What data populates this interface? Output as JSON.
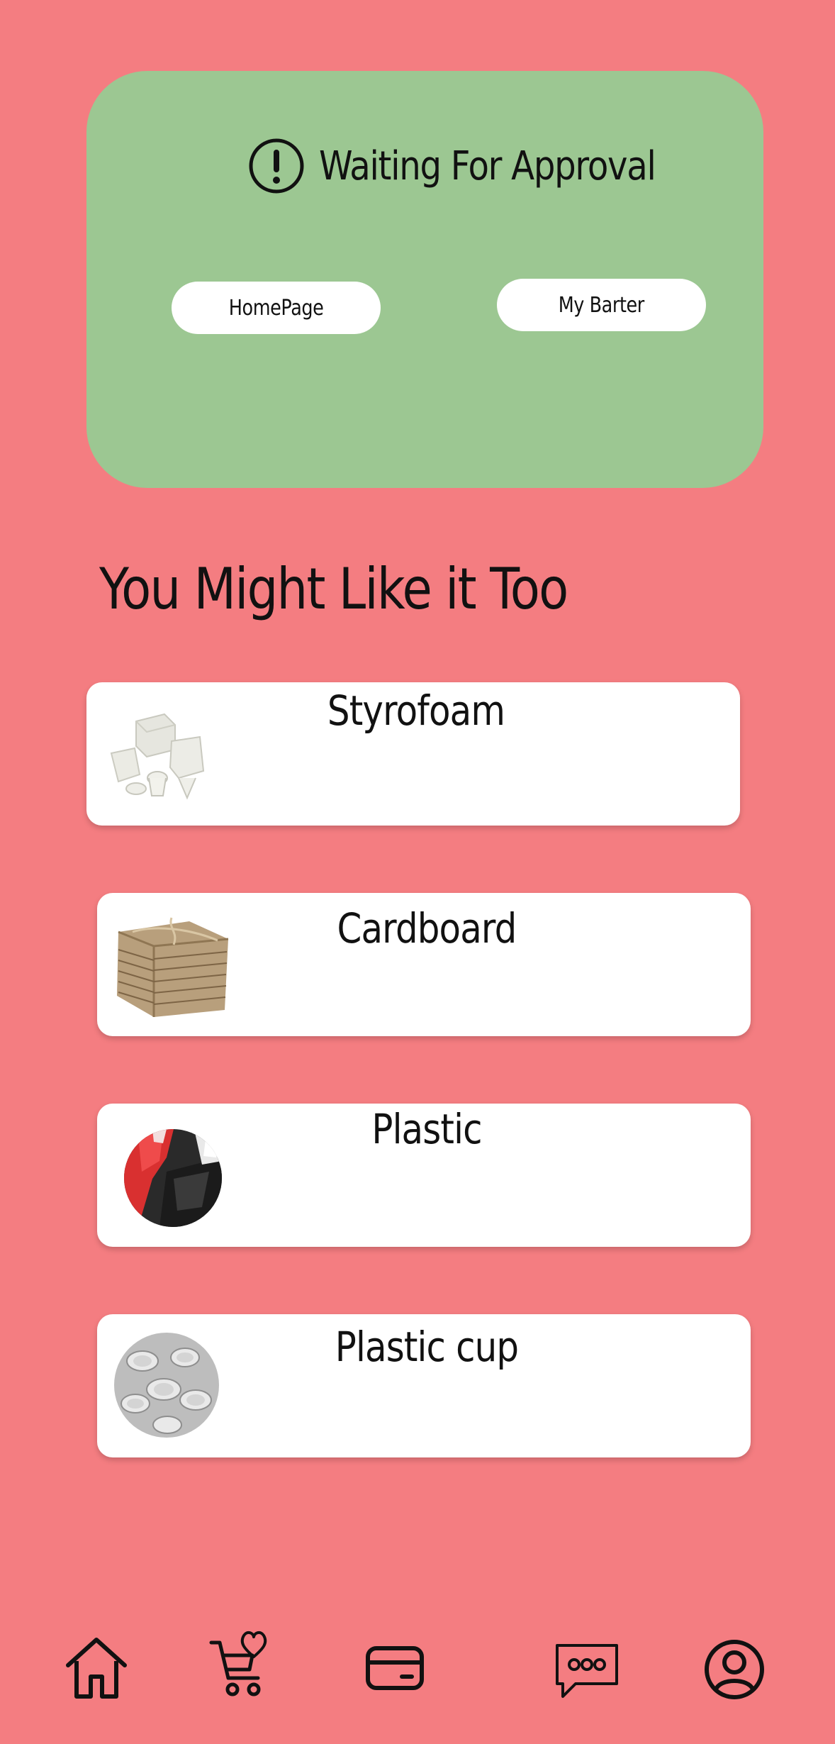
{
  "approval": {
    "status_text": "Waiting For Approval",
    "status_icon": "alert-circle-icon",
    "homepage_button": "HomePage",
    "mybarter_button": "My Barter"
  },
  "recommendations": {
    "title": "You Might Like it Too",
    "items": [
      {
        "label": "Styrofoam",
        "icon": "styrofoam-thumbnail"
      },
      {
        "label": "Cardboard",
        "icon": "cardboard-thumbnail"
      },
      {
        "label": "Plastic",
        "icon": "plastic-bags-thumbnail"
      },
      {
        "label": "Plastic cup",
        "icon": "plastic-cups-thumbnail"
      }
    ]
  },
  "nav": {
    "items": [
      {
        "icon": "home-icon"
      },
      {
        "icon": "cart-heart-icon"
      },
      {
        "icon": "card-icon"
      },
      {
        "icon": "chat-icon"
      },
      {
        "icon": "profile-icon"
      }
    ]
  },
  "colors": {
    "background": "#f47d81",
    "approval_card": "#9cc792",
    "card": "#ffffff"
  }
}
